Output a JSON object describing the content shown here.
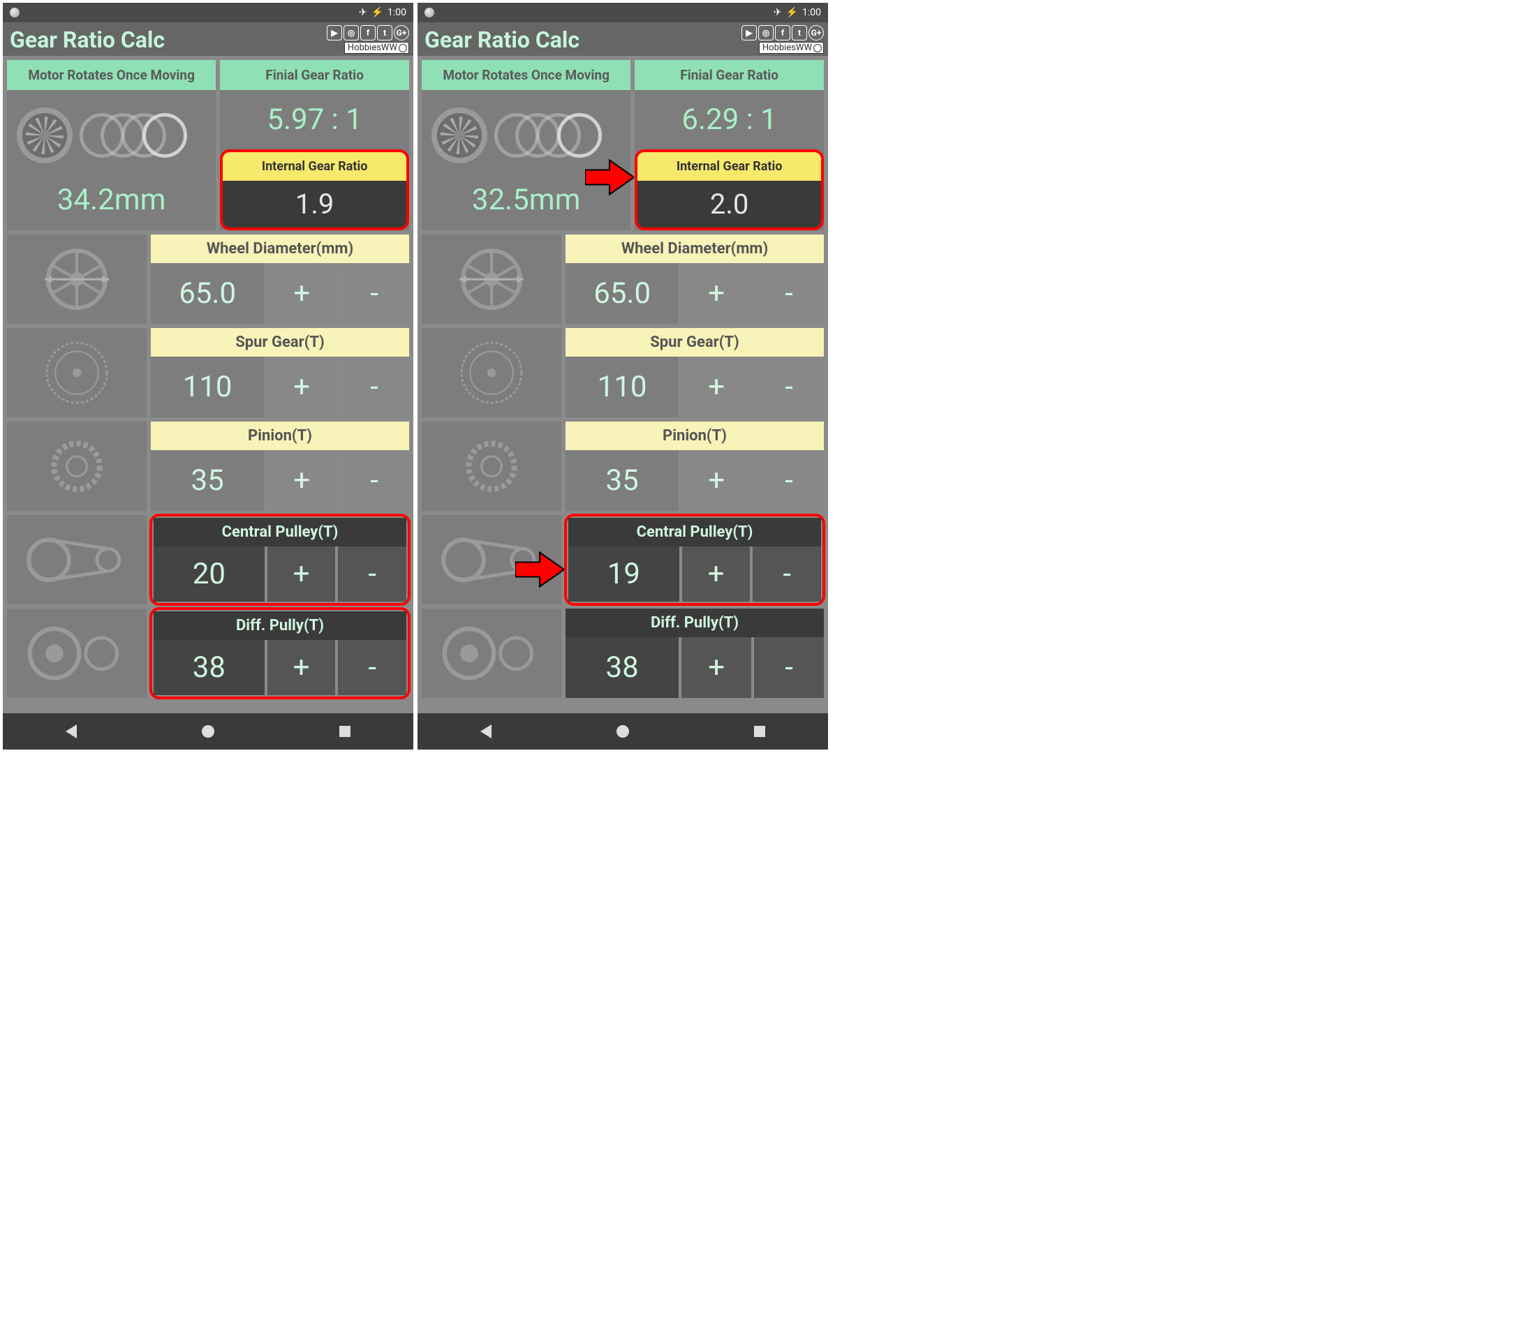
{
  "statusbar": {
    "time": "1:00"
  },
  "header": {
    "title": "Gear Ratio Calc",
    "search_tag": "HobbiesWW"
  },
  "labels": {
    "motor_rotates": "Motor Rotates Once Moving",
    "final_ratio": "Finial Gear Ratio",
    "internal_ratio": "Internal Gear Ratio",
    "wheel_diameter": "Wheel Diameter(mm)",
    "spur_gear": "Spur Gear(T)",
    "pinion": "Pinion(T)",
    "central_pulley": "Central Pulley(T)",
    "diff_pulley": "Diff. Pully(T)",
    "plus": "+",
    "minus": "-"
  },
  "screens": [
    {
      "mm": "34.2mm",
      "final_ratio": "5.97 : 1",
      "internal_ratio": "1.9",
      "wheel_diameter": "65.0",
      "spur_gear": "110",
      "pinion": "35",
      "central_pulley": "20",
      "diff_pulley": "38",
      "highlights": {
        "internal": true,
        "central": true,
        "diff": true,
        "arrows": false
      }
    },
    {
      "mm": "32.5mm",
      "final_ratio": "6.29 : 1",
      "internal_ratio": "2.0",
      "wheel_diameter": "65.0",
      "spur_gear": "110",
      "pinion": "35",
      "central_pulley": "19",
      "diff_pulley": "38",
      "highlights": {
        "internal": true,
        "central": true,
        "diff": false,
        "arrows": true
      }
    }
  ]
}
